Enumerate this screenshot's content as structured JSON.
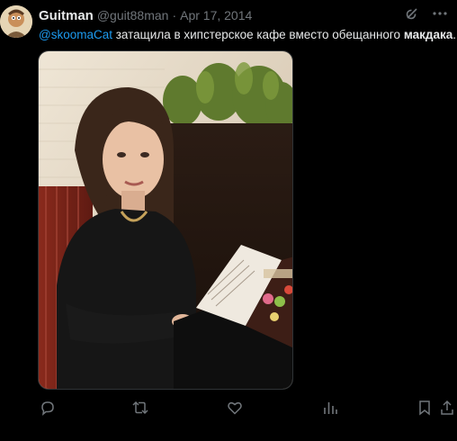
{
  "tweet": {
    "display_name": "Guitman",
    "handle": "@guit88man",
    "separator": "·",
    "date": "Apr 17, 2014",
    "text_mention": "@skoomaCat",
    "text_body": " затащила в хипстерское кафе вместо обещанного ",
    "text_bold": "макдака",
    "text_end": "."
  },
  "icons": {
    "grok": "grok-icon",
    "more": "more-icon",
    "reply": "reply-icon",
    "retweet": "retweet-icon",
    "like": "heart-icon",
    "views": "views-icon",
    "bookmark": "bookmark-icon",
    "share": "share-icon"
  },
  "colors": {
    "background": "#000000",
    "text": "#e7e9ea",
    "secondary": "#71767b",
    "accent": "#1d9bf0"
  }
}
